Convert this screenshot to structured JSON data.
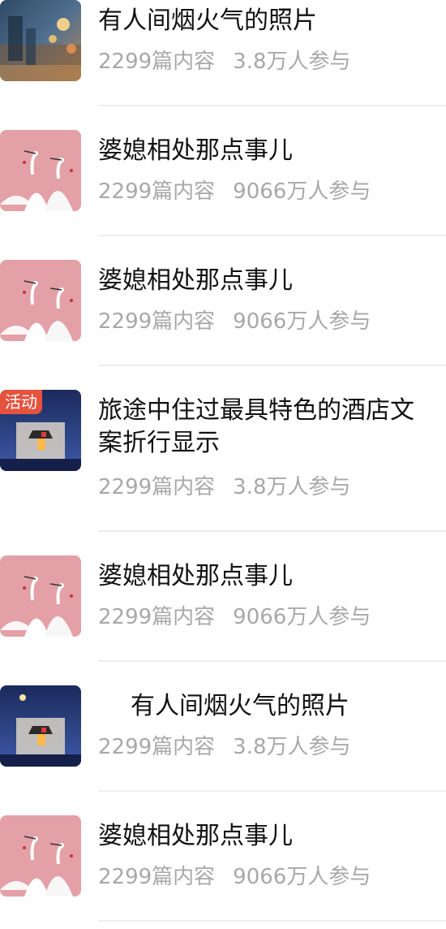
{
  "items": [
    {
      "title": "有人间烟火气的照片",
      "posts": "2299篇内容",
      "participants": "3.8万人参与",
      "thumbnail": "night-street-photo",
      "badge": null
    },
    {
      "title": "婆媳相处那点事儿",
      "posts": "2299篇内容",
      "participants": "9066万人参与",
      "thumbnail": "pink-crane-painting",
      "badge": null
    },
    {
      "title": "婆媳相处那点事儿",
      "posts": "2299篇内容",
      "participants": "9066万人参与",
      "thumbnail": "pink-crane-painting",
      "badge": null
    },
    {
      "title": "旅途中住过最具特色的酒店文案折行显示",
      "posts": "2299篇内容",
      "participants": "3.8万人参与",
      "thumbnail": "blue-lantern-night",
      "badge": "活动"
    },
    {
      "title": "婆媳相处那点事儿",
      "posts": "2299篇内容",
      "participants": "9066万人参与",
      "thumbnail": "pink-crane-painting",
      "badge": null
    },
    {
      "title": "有人间烟火气的照片",
      "posts": "2299篇内容",
      "participants": "3.8万人参与",
      "thumbnail": "blue-lantern-night",
      "badge": null
    },
    {
      "title": "婆媳相处那点事儿",
      "posts": "2299篇内容",
      "participants": "9066万人参与",
      "thumbnail": "pink-crane-painting",
      "badge": null
    }
  ],
  "colors": {
    "title": "#111111",
    "meta": "#a8a8a8",
    "divider": "#eeeeee",
    "badge": "#e5533f"
  }
}
